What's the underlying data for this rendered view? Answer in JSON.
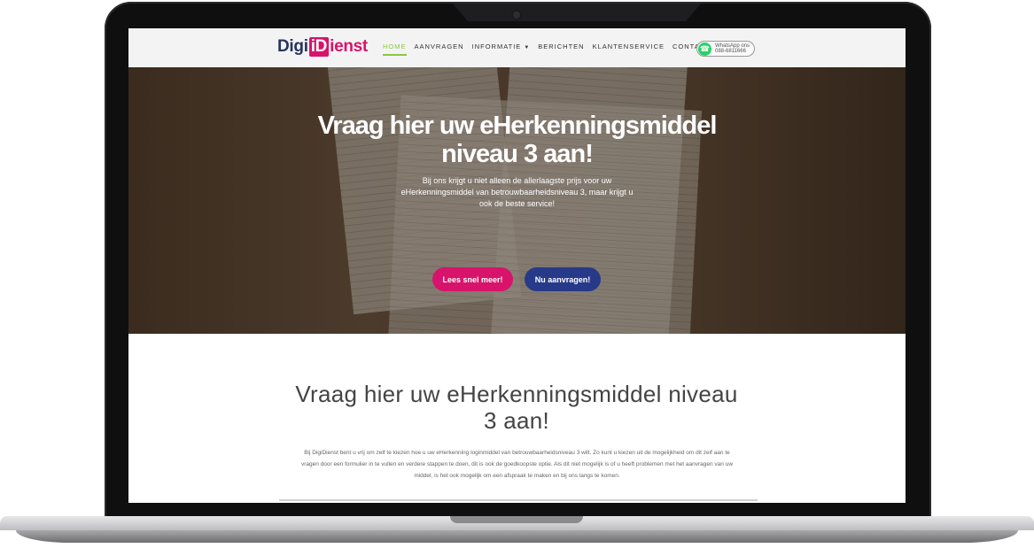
{
  "site": {
    "logo": {
      "part1": "Digi",
      "part2": "iD",
      "part3": "ienst"
    },
    "nav": [
      {
        "label": "HOME",
        "active": true,
        "dropdown": false
      },
      {
        "label": "AANVRAGEN",
        "active": false,
        "dropdown": false
      },
      {
        "label": "INFORMATIE",
        "active": false,
        "dropdown": true
      },
      {
        "label": "BERICHTEN",
        "active": false,
        "dropdown": false
      },
      {
        "label": "KLANTENSERVICE",
        "active": false,
        "dropdown": false
      },
      {
        "label": "CONTACT",
        "active": false,
        "dropdown": true
      }
    ],
    "whatsapp": {
      "line1": "WhatsApp ons",
      "line2": "088-6811666"
    },
    "colors": {
      "accent_green": "#8dc63f",
      "brand_pink": "#d8136b",
      "brand_blue": "#273a8a"
    }
  },
  "hero": {
    "title": "Vraag hier uw eHerkenningsmiddel niveau 3 aan!",
    "text": "Bij ons krijgt u niet alleen de allerlaagste prijs voor uw eHerkenningsmiddel van betrouwbaarheidsniveau 3, maar krijgt u ook de beste service!",
    "btn_primary": "Lees snel meer!",
    "btn_secondary": "Nu aanvragen!",
    "scroll_icon": "arrow-down-icon"
  },
  "content": {
    "title": "Vraag hier uw eHerkenningsmiddel niveau 3 aan!",
    "text": "Bij DigiDienst bent u vrij om zelf te kiezen hoe u uw eHerkenning loginmiddel van betrouwbaarheidsniveau 3 wilt. Zo kunt u kiezen uit de mogelijkheid om dit zelf aan te vragen door een formulier in te vullen en verdere stappen te doen, dit is ook de goedkoopste optie. Als dit niet mogelijk is of u heeft problemen met het aanvragen van uw middel, is het ook mogelijk om een afspraak te maken en bij ons langs te komen."
  }
}
